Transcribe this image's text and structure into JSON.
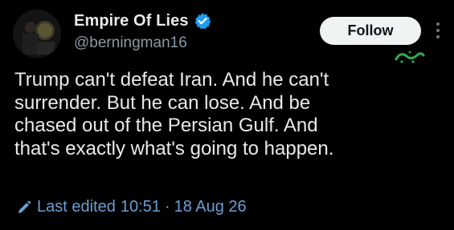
{
  "author": {
    "display_name": "Empire Of Lies",
    "handle": "@berningman16",
    "verified": true
  },
  "actions": {
    "follow_label": "Follow"
  },
  "tweet": {
    "text": "Trump can't defeat Iran. And he can't\nsurrender. But he can lose. And be\nchased out of the Persian Gulf. And\nthat's exactly what's going to happen."
  },
  "edit_info": {
    "prefix": "Last edited",
    "time": "10:51",
    "date": "18 Aug 26"
  },
  "icons": {
    "verified": "verified-badge-icon",
    "more": "more-options-icon",
    "edited": "pencil-icon"
  },
  "colors": {
    "background": "#000000",
    "text": "#e7e9ea",
    "secondary_text": "#8b98a5",
    "link": "#6b9fd3",
    "verified": "#1d9bf0",
    "follow_bg": "#eff3f4"
  }
}
